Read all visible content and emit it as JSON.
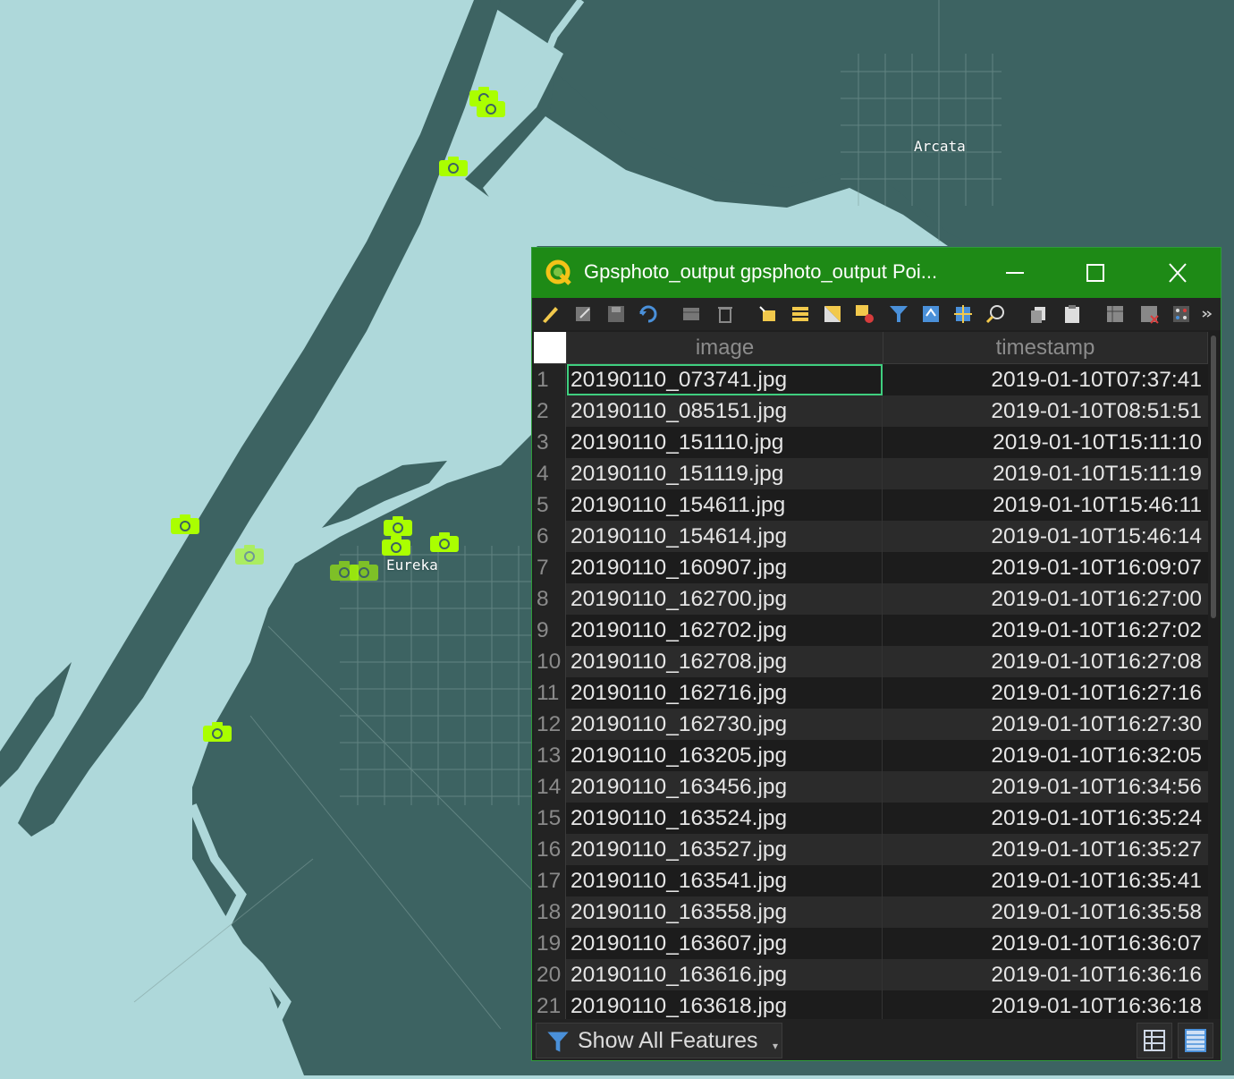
{
  "map": {
    "place_labels": [
      {
        "name": "arcata-label",
        "text": "Arcata"
      },
      {
        "name": "eureka-label",
        "text": "Eureka"
      }
    ],
    "marker_icon": "camera-icon",
    "colors": {
      "water": "#aed8da",
      "land": "#3d6362",
      "roads": "#7f9e9c",
      "marker": "#aaff00"
    }
  },
  "window": {
    "title": "Gpsphoto_output gpsphoto_output Poi...",
    "title_icon": "qgis-logo-icon",
    "controls": [
      "minimize-icon",
      "maximize-icon",
      "close-icon"
    ],
    "accent": "#1e8a16"
  },
  "toolbar": {
    "icons": [
      "toggle-editing-icon",
      "multi-edit-icon",
      "save-edits-icon",
      "reload-icon",
      "add-feature-icon",
      "delete-feature-icon",
      "select-by-expression-icon",
      "select-all-icon",
      "invert-selection-icon",
      "deselect-all-icon",
      "filter-selection-icon",
      "move-selection-to-top-icon",
      "pan-to-selection-icon",
      "zoom-to-selection-icon",
      "copy-icon",
      "paste-icon",
      "new-field-icon",
      "delete-field-icon",
      "field-calculator-icon",
      "more-icon"
    ]
  },
  "table": {
    "columns": [
      "image",
      "timestamp"
    ],
    "rows": [
      {
        "n": "1",
        "image": "20190110_073741.jpg",
        "timestamp": "2019-01-10T07:37:41"
      },
      {
        "n": "2",
        "image": "20190110_085151.jpg",
        "timestamp": "2019-01-10T08:51:51"
      },
      {
        "n": "3",
        "image": "20190110_151110.jpg",
        "timestamp": "2019-01-10T15:11:10"
      },
      {
        "n": "4",
        "image": "20190110_151119.jpg",
        "timestamp": "2019-01-10T15:11:19"
      },
      {
        "n": "5",
        "image": "20190110_154611.jpg",
        "timestamp": "2019-01-10T15:46:11"
      },
      {
        "n": "6",
        "image": "20190110_154614.jpg",
        "timestamp": "2019-01-10T15:46:14"
      },
      {
        "n": "7",
        "image": "20190110_160907.jpg",
        "timestamp": "2019-01-10T16:09:07"
      },
      {
        "n": "8",
        "image": "20190110_162700.jpg",
        "timestamp": "2019-01-10T16:27:00"
      },
      {
        "n": "9",
        "image": "20190110_162702.jpg",
        "timestamp": "2019-01-10T16:27:02"
      },
      {
        "n": "10",
        "image": "20190110_162708.jpg",
        "timestamp": "2019-01-10T16:27:08"
      },
      {
        "n": "11",
        "image": "20190110_162716.jpg",
        "timestamp": "2019-01-10T16:27:16"
      },
      {
        "n": "12",
        "image": "20190110_162730.jpg",
        "timestamp": "2019-01-10T16:27:30"
      },
      {
        "n": "13",
        "image": "20190110_163205.jpg",
        "timestamp": "2019-01-10T16:32:05"
      },
      {
        "n": "14",
        "image": "20190110_163456.jpg",
        "timestamp": "2019-01-10T16:34:56"
      },
      {
        "n": "15",
        "image": "20190110_163524.jpg",
        "timestamp": "2019-01-10T16:35:24"
      },
      {
        "n": "16",
        "image": "20190110_163527.jpg",
        "timestamp": "2019-01-10T16:35:27"
      },
      {
        "n": "17",
        "image": "20190110_163541.jpg",
        "timestamp": "2019-01-10T16:35:41"
      },
      {
        "n": "18",
        "image": "20190110_163558.jpg",
        "timestamp": "2019-01-10T16:35:58"
      },
      {
        "n": "19",
        "image": "20190110_163607.jpg",
        "timestamp": "2019-01-10T16:36:07"
      },
      {
        "n": "20",
        "image": "20190110_163616.jpg",
        "timestamp": "2019-01-10T16:36:16"
      },
      {
        "n": "21",
        "image": "20190110_163618.jpg",
        "timestamp": "2019-01-10T16:36:18"
      }
    ]
  },
  "statusbar": {
    "filter_label": "Show All Features",
    "filter_icon": "funnel-icon",
    "view_buttons": [
      "form-view-icon",
      "table-view-icon"
    ]
  }
}
